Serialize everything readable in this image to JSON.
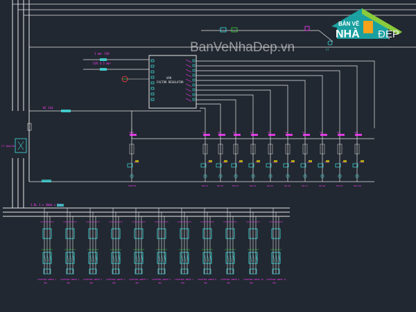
{
  "watermark": {
    "text": "BanVeNhaDep.vn",
    "logo_line1": "BẢN VẼ",
    "logo_nha": "NHÀ",
    "logo_dep": "ĐẸP",
    "color": "#f5f5f5"
  },
  "regulator": {
    "label_line1": "VAR",
    "label_line2": "FACTOR REGULATOR"
  },
  "top_feeder_labels": [
    "1 mm² CVV",
    "CVV 4.5 mm²",
    "HC 2x4"
  ],
  "left_panel_label": "CT 400/5A",
  "busbar_label": "3.0L 1 x 30mm x 5mm",
  "capacitor_steps": [
    "CB-B",
    "S1",
    "S2",
    "S3",
    "S4",
    "S5",
    "S6",
    "S7",
    "S8",
    "S9",
    "S10"
  ],
  "step_bottom_labels": [
    "SWITCH",
    "SW-S1",
    "SW-S2",
    "SW-S3",
    "SW-S4",
    "SW-S5",
    "SW-S6",
    "SW-S7",
    "SW-S8",
    "SW-S9",
    "SW-S10"
  ],
  "feeders": [
    {
      "name": "LIGHTING GROUP 1",
      "rating": "40A"
    },
    {
      "name": "LIGHTING GROUP 2",
      "rating": "40A"
    },
    {
      "name": "LIGHTING GROUP 3",
      "rating": "40A"
    },
    {
      "name": "LIGHTING GROUP 4",
      "rating": "40A"
    },
    {
      "name": "LIGHTING GROUP 5",
      "rating": "40A"
    },
    {
      "name": "LIGHTING GROUP 6",
      "rating": "40A"
    },
    {
      "name": "LIGHTING GROUP 7",
      "rating": "40A"
    },
    {
      "name": "LIGHTING GROUP 8",
      "rating": "40A"
    },
    {
      "name": "LIGHTING GROUP 9",
      "rating": "40A"
    },
    {
      "name": "LIGHTING GROUP 10",
      "rating": "40A"
    },
    {
      "name": "LIGHTING GROUP 11",
      "rating": "40A"
    }
  ],
  "colors": {
    "background": "#222831",
    "wire": "#e8e8e8",
    "magenta": "#ff3cff",
    "cyan": "#3ee6e6",
    "green": "#3cd83c",
    "yellow": "#e8e000",
    "red": "#ff4040"
  }
}
